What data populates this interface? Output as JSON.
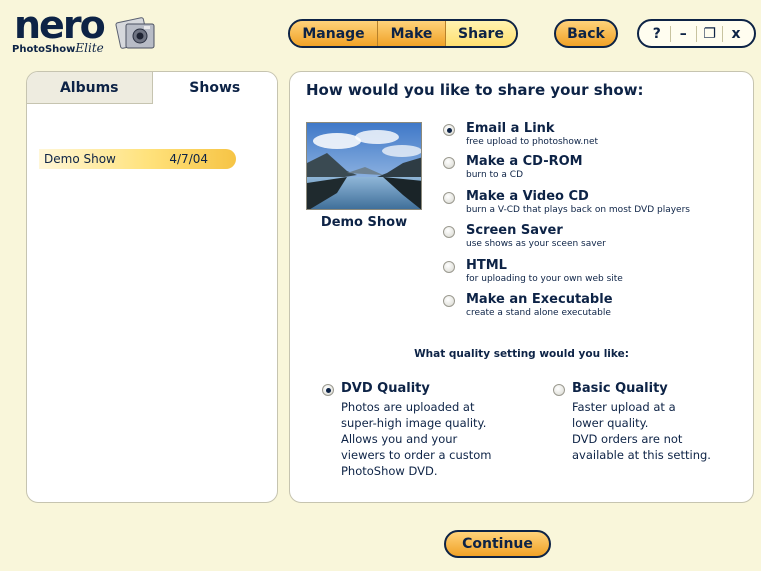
{
  "logo": {
    "brand": "nero",
    "product": "PhotoShow",
    "edition": "Elite"
  },
  "nav": {
    "manage": "Manage",
    "make": "Make",
    "share": "Share",
    "back": "Back"
  },
  "window": {
    "help": "?",
    "minimize": "–",
    "restore": "❐",
    "close": "x"
  },
  "left": {
    "tabs": [
      "Albums",
      "Shows"
    ],
    "shows": [
      {
        "name": "Demo Show",
        "date": "4/7/04"
      }
    ]
  },
  "right": {
    "title": "How would you like to share your show:",
    "thumb_caption": "Demo Show",
    "options": [
      {
        "label": "Email a Link",
        "sub": "free upload to photoshow.net",
        "selected": true
      },
      {
        "label": "Make a CD-ROM",
        "sub": "burn to a CD",
        "selected": false
      },
      {
        "label": "Make a Video CD",
        "sub": "burn a V-CD that plays back on most DVD players",
        "selected": false
      },
      {
        "label": "Screen Saver",
        "sub": "use shows as your sceen saver",
        "selected": false
      },
      {
        "label": "HTML",
        "sub": "for uploading to your own web site",
        "selected": false
      },
      {
        "label": "Make an Executable",
        "sub": "create a stand alone executable",
        "selected": false
      }
    ],
    "quality_title": "What quality setting would you like:",
    "quality": [
      {
        "label": "DVD Quality",
        "lines": [
          "Photos are uploaded at",
          "super-high image quality.",
          "Allows you and your",
          "viewers to order a custom",
          "PhotoShow DVD."
        ],
        "selected": true
      },
      {
        "label": "Basic Quality",
        "lines": [
          "Faster upload at a",
          "lower quality.",
          "DVD orders are not",
          "available at this setting."
        ],
        "selected": false
      }
    ]
  },
  "continue": "Continue"
}
